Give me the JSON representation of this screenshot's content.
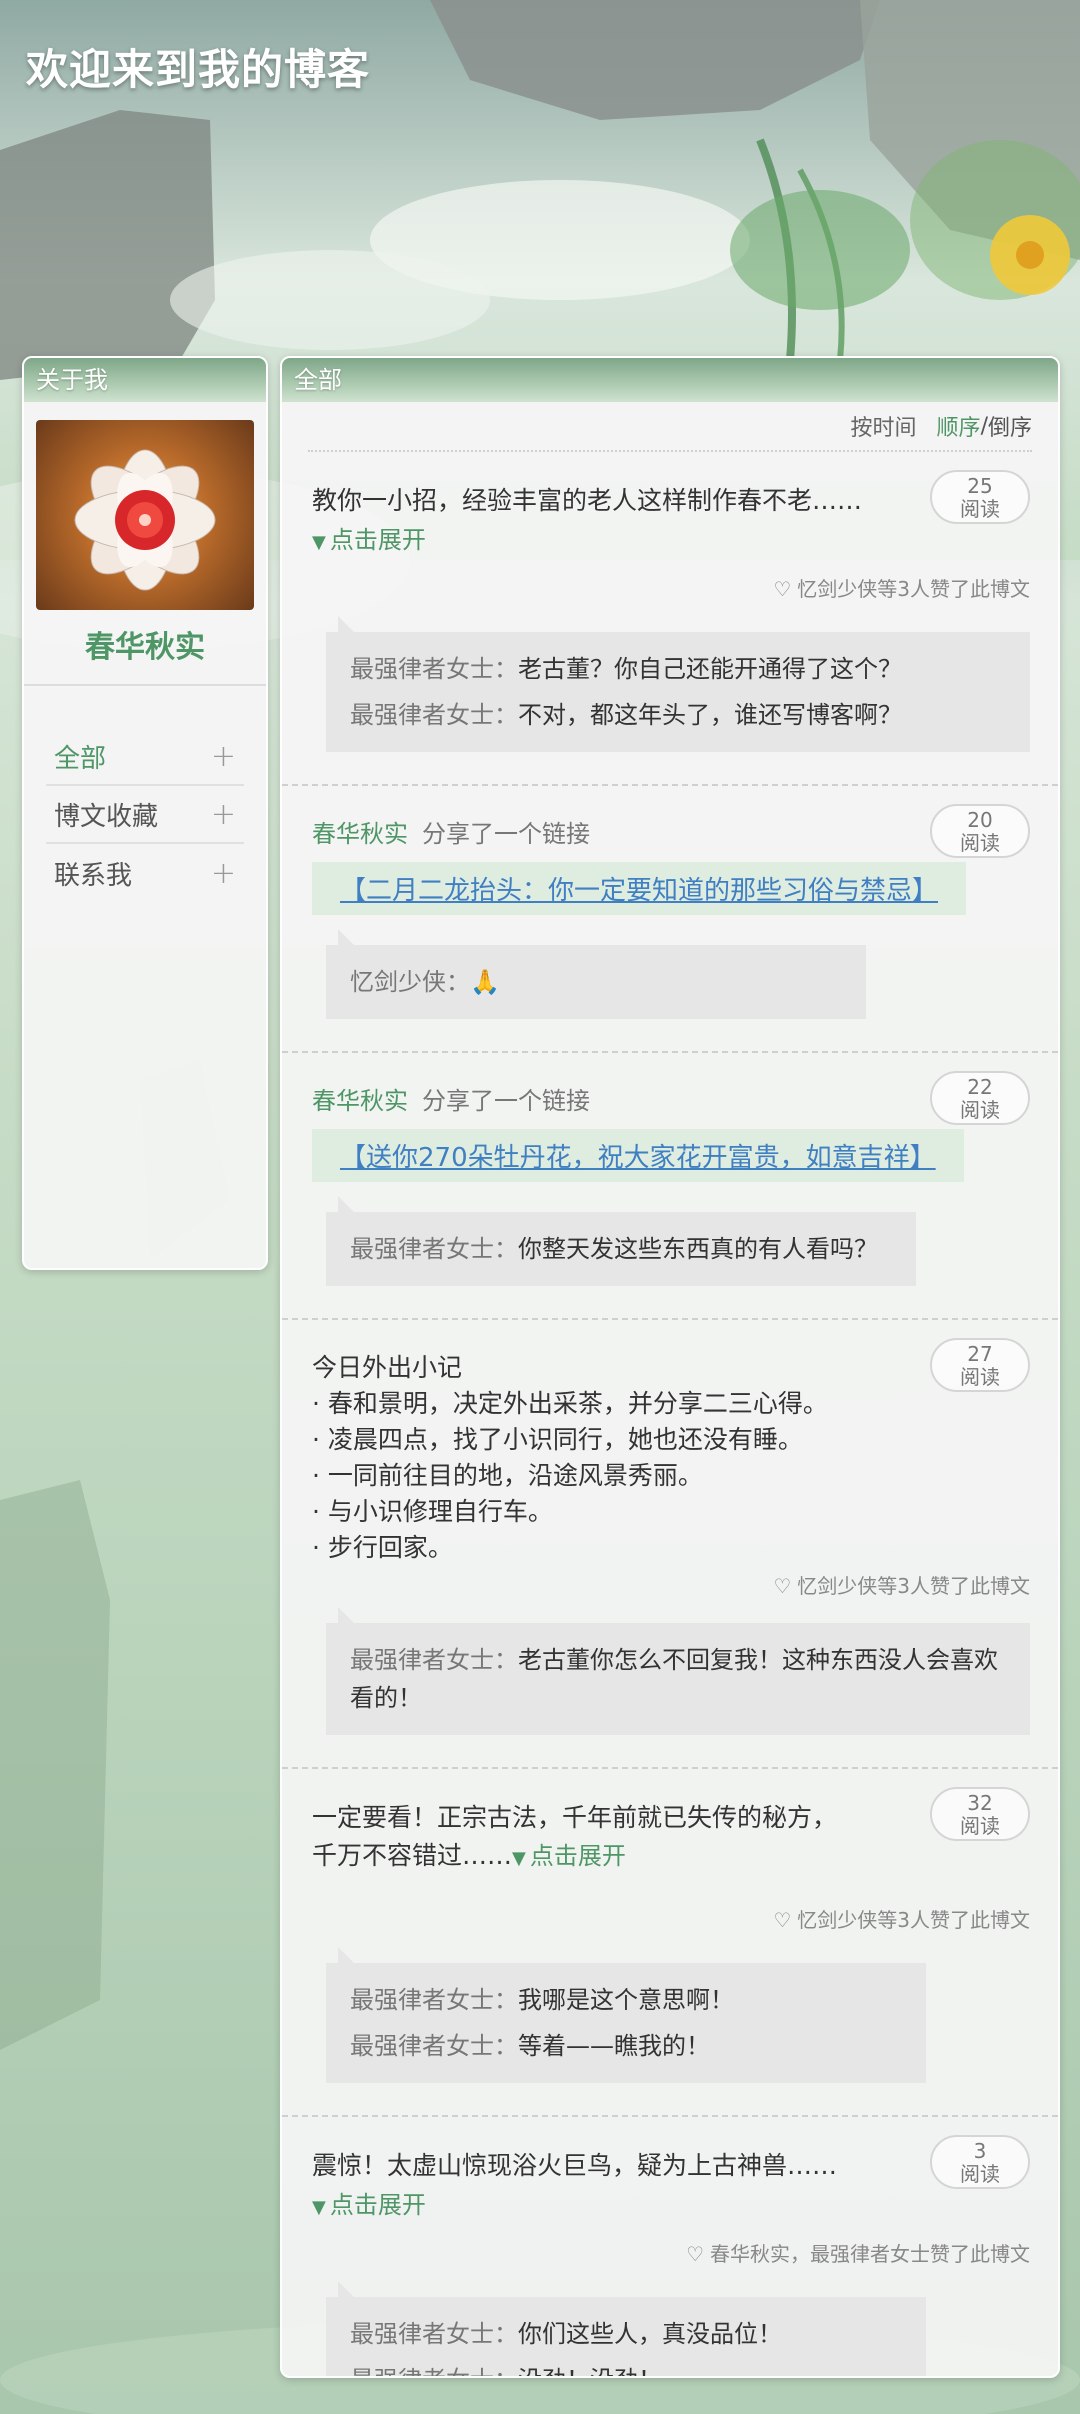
{
  "site": {
    "title": "欢迎来到我的博客"
  },
  "sidebar": {
    "header": "关于我",
    "username": "春华秋实",
    "nav": [
      {
        "label": "全部",
        "active": true
      },
      {
        "label": "博文收藏",
        "active": false
      },
      {
        "label": "联系我",
        "active": false
      }
    ]
  },
  "main": {
    "header": "全部",
    "sort": {
      "label": "按时间",
      "asc": "顺序",
      "separator": "/",
      "desc": "倒序"
    },
    "expand_label": "点击展开",
    "posts": [
      {
        "text": "教你一小招，经验丰富的老人这样制作春不老……",
        "reads": "25",
        "read_label": "阅读",
        "likes": "忆剑少侠等3人赞了此博文",
        "comments": [
          {
            "author": "最强律者女士：",
            "text": "老古董？你自己还能开通得了这个？"
          },
          {
            "author": "最强律者女士：",
            "text": "不对，都这年头了，谁还写博客啊？"
          }
        ]
      },
      {
        "sharer": "春华秋实",
        "action": "分享了一个链接",
        "link": "【二月二龙抬头：你一定要知道的那些习俗与禁忌】",
        "reads": "20",
        "read_label": "阅读",
        "comments": [
          {
            "author": "忆剑少侠：",
            "text": "🙏"
          }
        ]
      },
      {
        "sharer": "春华秋实",
        "action": "分享了一个链接",
        "link": "【送你270朵牡丹花，祝大家花开富贵，如意吉祥】",
        "reads": "22",
        "read_label": "阅读",
        "comments": [
          {
            "author": "最强律者女士：",
            "text": "你整天发这些东西真的有人看吗？"
          }
        ]
      },
      {
        "lines": [
          "今日外出小记",
          "· 春和景明，决定外出采茶，并分享二三心得。",
          "· 凌晨四点，找了小识同行，她也还没有睡。",
          "· 一同前往目的地，沿途风景秀丽。",
          "· 与小识修理自行车。",
          "· 步行回家。"
        ],
        "reads": "27",
        "read_label": "阅读",
        "likes": "忆剑少侠等3人赞了此博文",
        "comments": [
          {
            "author": "最强律者女士：",
            "text": "老古董你怎么不回复我！这种东西没人会喜欢看的！"
          }
        ]
      },
      {
        "text_line1": "一定要看！正宗古法，千年前就已失传的秘方，",
        "text_line2": "千万不容错过……",
        "reads": "32",
        "read_label": "阅读",
        "likes": "忆剑少侠等3人赞了此博文",
        "comments": [
          {
            "author": "最强律者女士：",
            "text": "我哪是这个意思啊！"
          },
          {
            "author": "最强律者女士：",
            "text": "等着——瞧我的！"
          }
        ]
      },
      {
        "text": "震惊！太虚山惊现浴火巨鸟，疑为上古神兽……",
        "reads": "3",
        "read_label": "阅读",
        "likes": "春华秋实，最强律者女士赞了此博文",
        "comments": [
          {
            "author": "最强律者女士：",
            "text": "你们这些人，真没品位！"
          },
          {
            "author": "最强律者女士：",
            "text": "没劲！没劲！"
          }
        ]
      }
    ]
  },
  "icons": {
    "heart": "heart-outline-icon",
    "plus": "plus-icon",
    "triangle": "triangle-down-icon"
  },
  "colors": {
    "accent": "#4f9667",
    "link": "#3f7fc2",
    "link_bg": "#dfece0"
  }
}
